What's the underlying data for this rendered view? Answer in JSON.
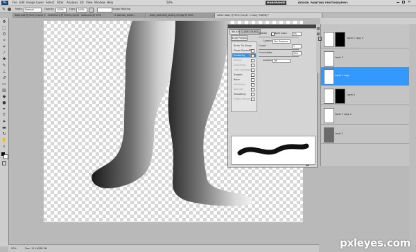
{
  "app": {
    "logo": "Ps",
    "menus": [
      "File",
      "Edit",
      "Image",
      "Layer",
      "Select",
      "Filter",
      "Analysis",
      "3D",
      "View",
      "Window",
      "Help"
    ],
    "zoom": "50%",
    "workspaces": [
      "DESIGN",
      "PAINTING",
      "PHOTOGRAPHY"
    ],
    "active_workspace": "MANORANGE",
    "more": "»"
  },
  "options": {
    "mode_label": "Mode:",
    "mode_value": "Normal",
    "opacity_label": "Opacity:",
    "opacity_value": "100%",
    "flow_label": "Flow:",
    "flow_value": "100%",
    "smooth": "Shape Painting"
  },
  "tabs": [
    "walk.psd @ 50% (Layer 1 copy, RGB/8)",
    "Untitled-1 @ 100% (Layer 1, RGB/8)",
    "walk.psd @ 50%",
    "5 woman_walki...",
    "walk_textured_shoes_04.jpg @ 50%",
    "white body @ 50% (Layer 1 copy, RGB/8) *"
  ],
  "brush_panel": {
    "tabs": [
      "BRUSH",
      "CLONE SOURCE"
    ],
    "preset_button": "Brush Presets",
    "items": [
      {
        "label": "Brush Tip Shape",
        "checked": false,
        "selected": false
      },
      {
        "label": "Shape Dynamics",
        "checked": true,
        "selected": false
      },
      {
        "label": "Scattering",
        "checked": true,
        "selected": true
      },
      {
        "label": "Texture",
        "checked": false,
        "selected": false
      },
      {
        "label": "Dual Brush",
        "checked": false,
        "selected": false
      },
      {
        "label": "Color Dynamics",
        "checked": false,
        "selected": false
      },
      {
        "label": "Transfer",
        "checked": true,
        "selected": false
      },
      {
        "label": "Noise",
        "checked": false,
        "selected": false
      },
      {
        "label": "Wet Edges",
        "checked": false,
        "selected": false
      },
      {
        "label": "Airbrush",
        "checked": false,
        "selected": false
      },
      {
        "label": "Smoothing",
        "checked": true,
        "selected": false
      },
      {
        "label": "Protect Texture",
        "checked": false,
        "selected": false
      }
    ],
    "scatter_label": "Scatter",
    "both_axes": "Both Axes",
    "scatter_value": "0%",
    "control_label": "Control:",
    "control_value": "Pen Pressure",
    "count_label": "Count",
    "count_value": "1",
    "count_jitter_label": "Count Jitter",
    "count_jitter_value": "50%",
    "control2_label": "Control:",
    "control2_value": "Off"
  },
  "layers": [
    {
      "name": "Layer 1 copy 4",
      "mask": true,
      "selected": false
    },
    {
      "name": "Layer 3",
      "mask": false,
      "selected": false
    },
    {
      "name": "Layer 1 copy",
      "mask": false,
      "selected": true
    },
    {
      "name": "Layer 4",
      "mask": true,
      "selected": false
    },
    {
      "name": "Layer 1 copy 2",
      "mask": false,
      "selected": false
    },
    {
      "name": "Layer 2",
      "mask": false,
      "selected": false
    }
  ],
  "status": {
    "zoom": "50%",
    "doc": "Doc: 11.1M/38.3M"
  },
  "watermark": "pxleyes.com",
  "colors": {
    "selection": "#3399ff",
    "workspace_bg": "#b9b9b9",
    "panel_bg": "#d4d4d4",
    "brush_selected": "#3a8fe0"
  }
}
